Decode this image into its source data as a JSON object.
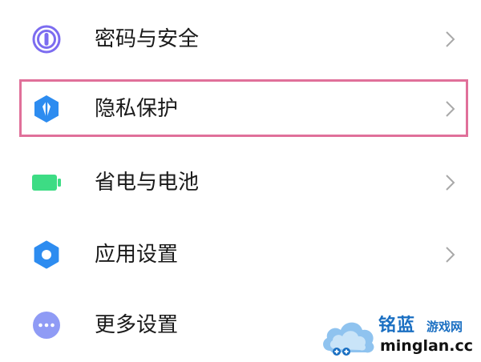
{
  "settings": {
    "items": [
      {
        "label": "密码与安全",
        "icon": "fingerprint-icon",
        "icon_color": "#7c6cf0"
      },
      {
        "label": "隐私保护",
        "icon": "shield-icon",
        "icon_color": "#2d8cf0"
      },
      {
        "label": "省电与电池",
        "icon": "battery-icon",
        "icon_color": "#3ddc84"
      },
      {
        "label": "应用设置",
        "icon": "gear-icon",
        "icon_color": "#2d8cf0"
      },
      {
        "label": "更多设置",
        "icon": "more-dots-icon",
        "icon_color": "#8f9bf5"
      }
    ],
    "highlighted_item": "隐私保护",
    "highlight_color": "#e0709a"
  },
  "watermark": {
    "brand": "铭蓝",
    "subtitle": "游戏网",
    "domain": "minglan.cc",
    "color": "#1a6fc2"
  }
}
